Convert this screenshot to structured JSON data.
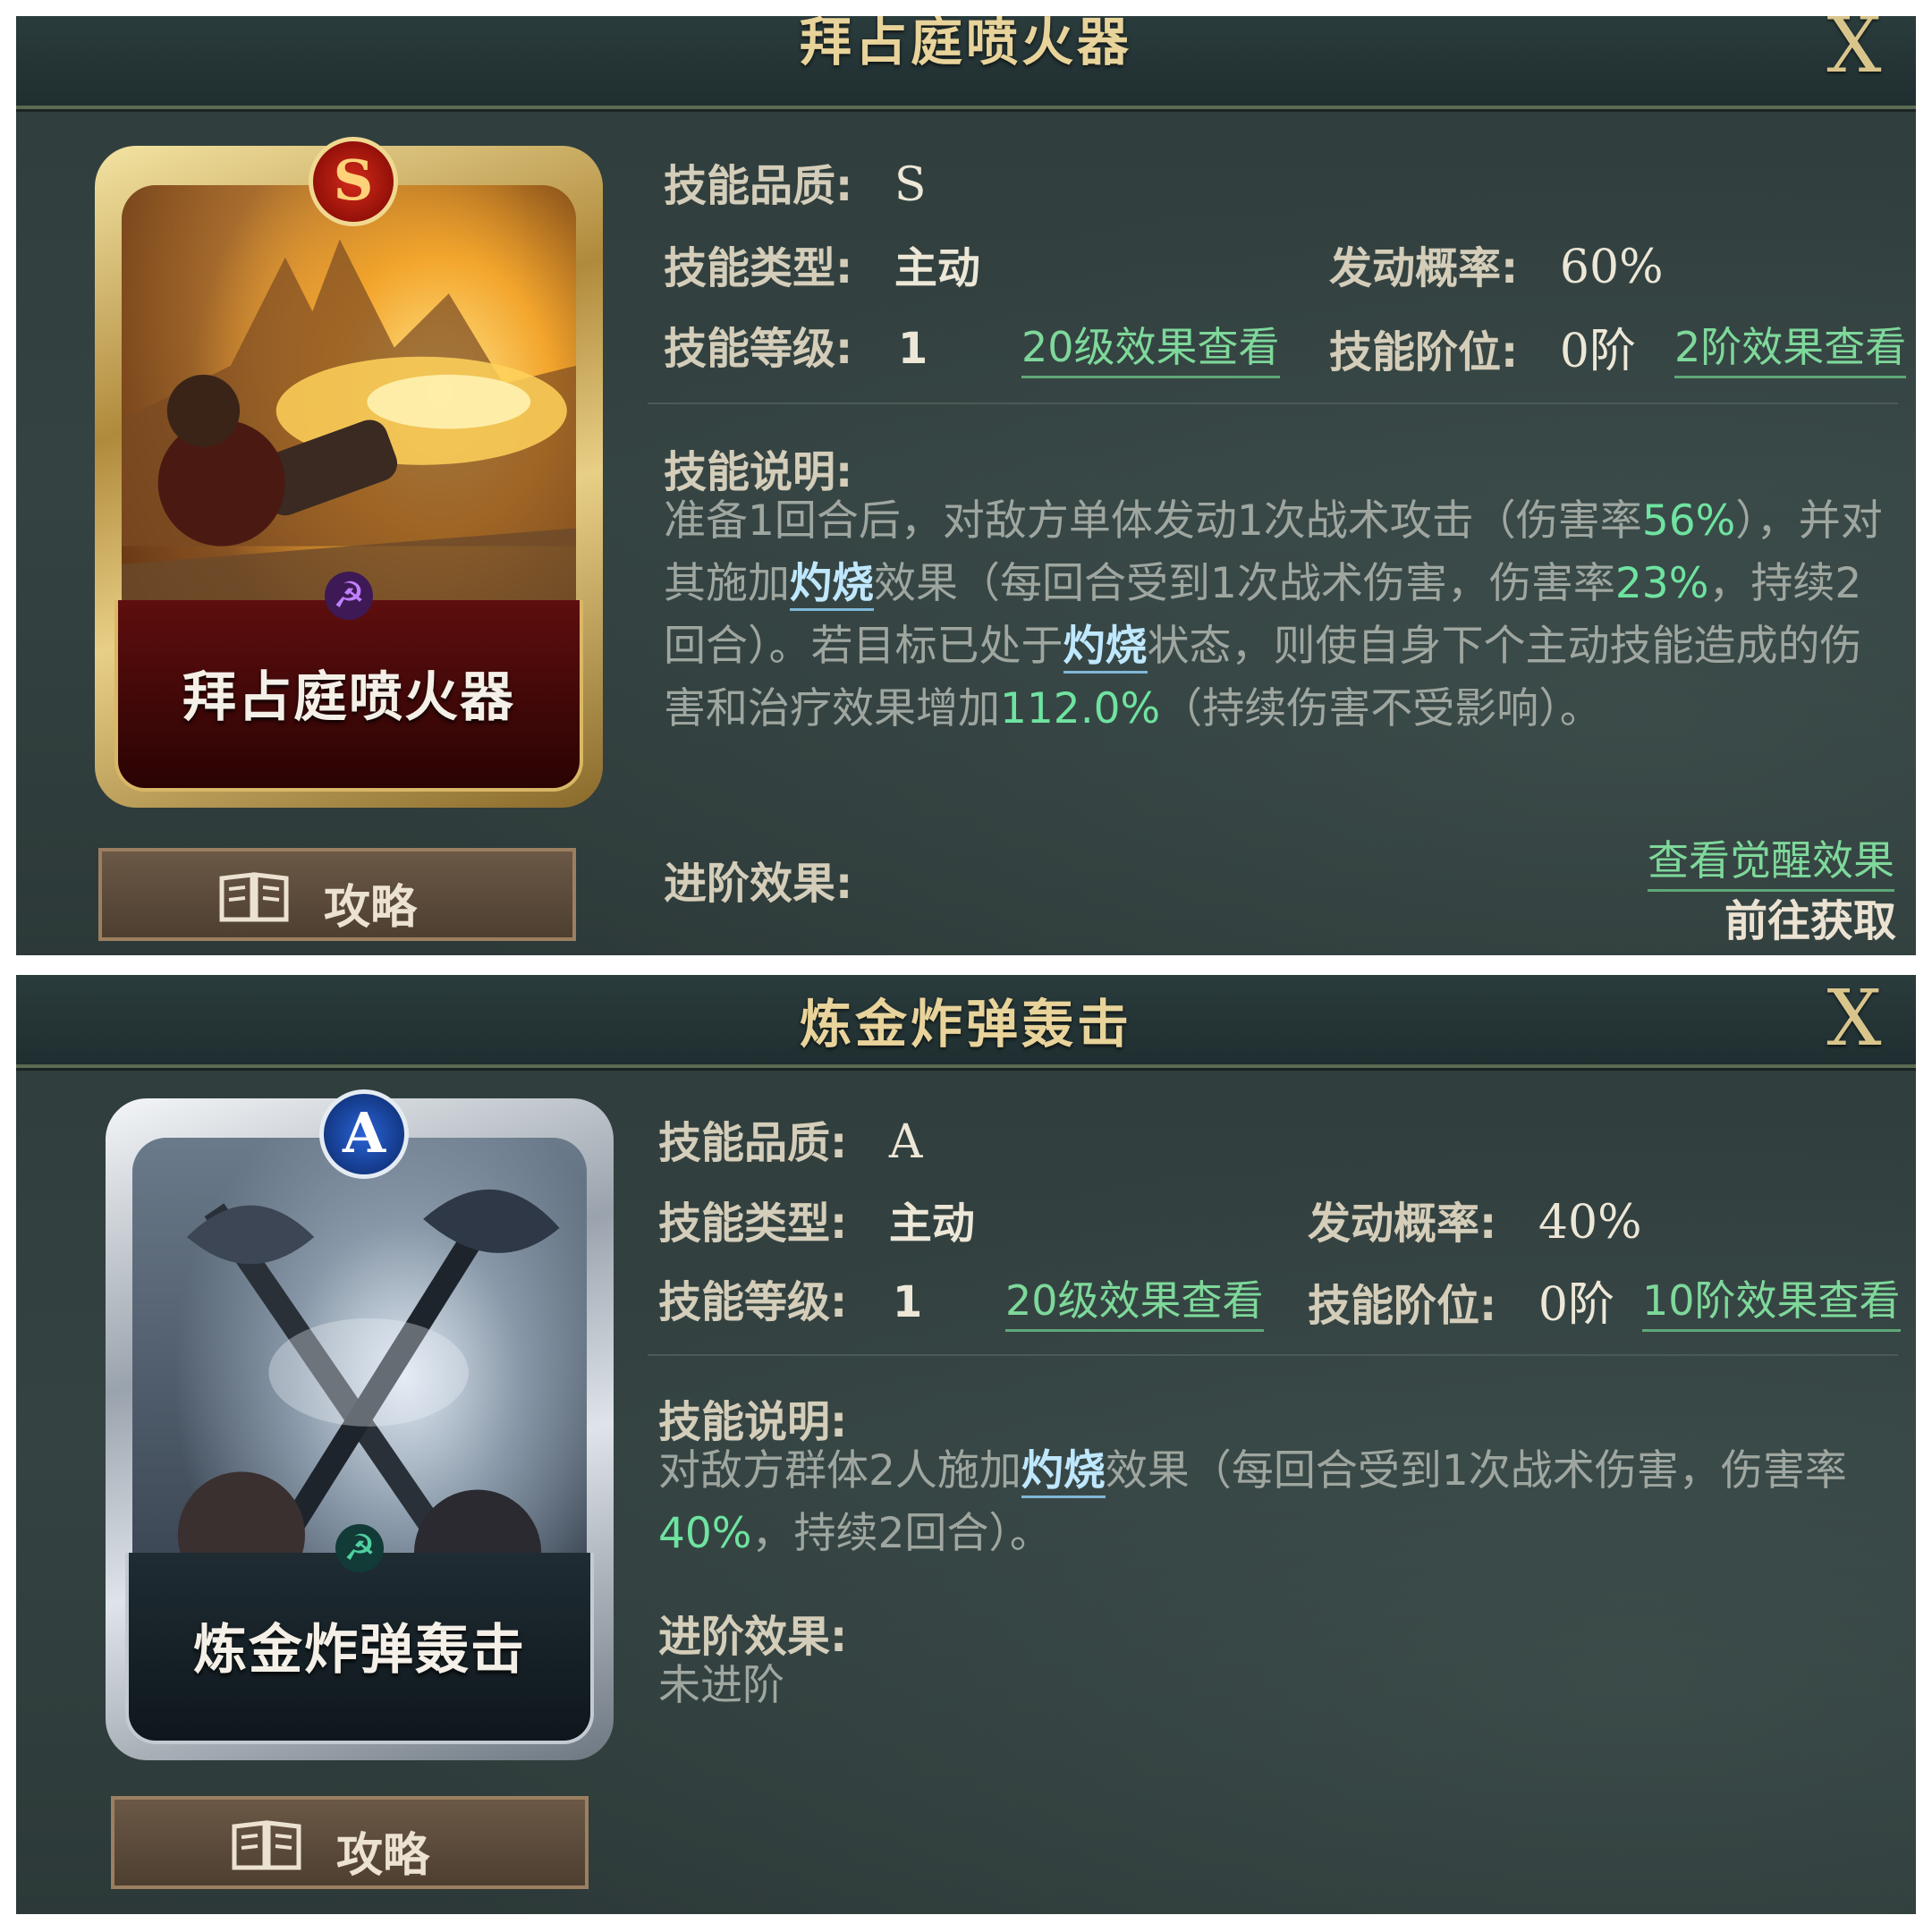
{
  "panels": [
    {
      "title": "拜占庭喷火器",
      "close": "X",
      "card": {
        "rank": "S",
        "name": "拜占庭喷火器",
        "emblem": "☭"
      },
      "guide_label": "攻略",
      "quality_label": "技能品质:",
      "quality_value": "S",
      "type_label": "技能类型:",
      "type_value": "主动",
      "rate_label": "发动概率:",
      "rate_value": "60%",
      "level_label": "技能等级:",
      "level_value": "1",
      "level_link": "20级效果查看",
      "tier_label": "技能阶位:",
      "tier_value": "0阶",
      "tier_link": "2阶效果查看",
      "desc_label": "技能说明:",
      "desc": {
        "t1": "准备1回合后，对敌方单体发动1次战术攻击（伤害率",
        "h1": "56%",
        "t2": "），并对其施加",
        "k1": "灼烧",
        "t3": "效果（每回合受到1次战术伤害，伤害率",
        "h2": "23%",
        "t4": "，持续2回合）。若目标已处于",
        "k2": "灼烧",
        "t5": "状态，则使自身下个主动技能造成的伤害和治疗效果增加",
        "h3": "112.0%",
        "t6": "（持续伤害不受影响）。"
      },
      "advance_label": "进阶效果:",
      "awaken_link": "查看觉醒效果",
      "goto_label": "前往获取"
    },
    {
      "title": "炼金炸弹轰击",
      "close": "X",
      "card": {
        "rank": "A",
        "name": "炼金炸弹轰击",
        "emblem": "☭"
      },
      "guide_label": "攻略",
      "quality_label": "技能品质:",
      "quality_value": "A",
      "type_label": "技能类型:",
      "type_value": "主动",
      "rate_label": "发动概率:",
      "rate_value": "40%",
      "level_label": "技能等级:",
      "level_value": "1",
      "level_link": "20级效果查看",
      "tier_label": "技能阶位:",
      "tier_value": "0阶",
      "tier_link": "10阶效果查看",
      "desc_label": "技能说明:",
      "desc": {
        "t1": "对敌方群体2人施加",
        "k1": "灼烧",
        "t2": "效果（每回合受到1次战术伤害，伤害率",
        "h1": "40%",
        "t3": "，持续2回合）。"
      },
      "advance_label": "进阶效果:",
      "advance_value": "未进阶"
    }
  ],
  "colors": {
    "gold": "#e8d39a",
    "green": "#7ed89a",
    "highlight": "#6fe3a0",
    "keyword": "#bfe8ff"
  },
  "icons": {
    "close": "close-icon",
    "guide": "book-icon"
  }
}
